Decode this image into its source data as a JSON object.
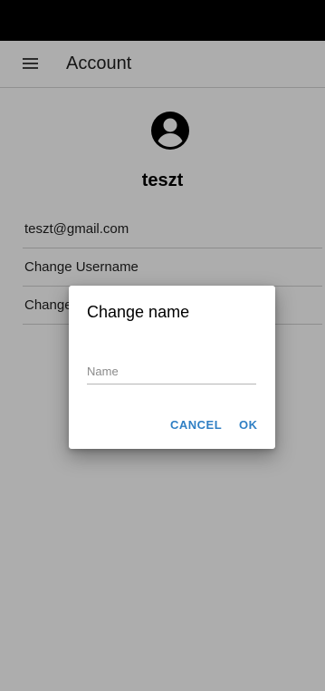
{
  "app_bar": {
    "title": "Account",
    "menu_icon": "hamburger-menu-icon"
  },
  "profile": {
    "avatar_icon": "account-circle-icon",
    "username": "teszt"
  },
  "list": {
    "items": [
      {
        "label": "teszt@gmail.com"
      },
      {
        "label": "Change Username"
      },
      {
        "label": "Change Password"
      }
    ]
  },
  "dialog": {
    "title": "Change name",
    "input_placeholder": "Name",
    "input_value": "",
    "cancel_label": "CANCEL",
    "ok_label": "OK"
  },
  "colors": {
    "accent": "#2f7fc4",
    "status_bar": "#000000",
    "scrim": "rgba(0,0,0,0.32)"
  }
}
